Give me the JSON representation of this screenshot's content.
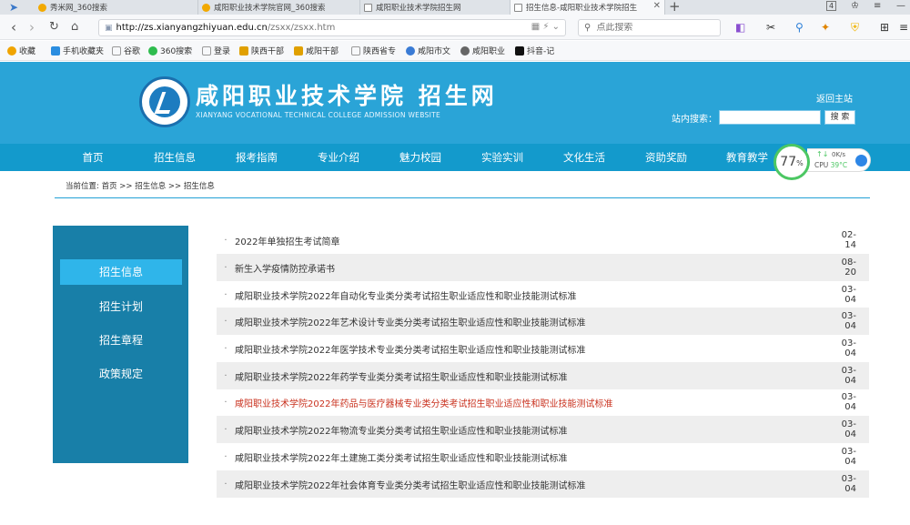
{
  "browser": {
    "tabs": [
      {
        "label": "秀米网_360搜索",
        "active": false
      },
      {
        "label": "咸阳职业技术学院官网_360搜索",
        "active": false
      },
      {
        "label": "咸阳职业技术学院招生网",
        "active": false
      },
      {
        "label": "招生信息-咸阳职业技术学院招生",
        "active": true
      }
    ],
    "tab_count_badge": "4",
    "url_host": "http://zs.xianyangzhiyuan.edu.cn",
    "url_path": "/zsxx/zsxx.htm",
    "search_placeholder": "点此搜索",
    "bookmarks": [
      {
        "label": "收藏",
        "color": "#f0a400"
      },
      {
        "label": "手机收藏夹",
        "color": "#2a8de0"
      },
      {
        "label": "谷歌",
        "color": "#999999"
      },
      {
        "label": "360搜索",
        "color": "#2ebc4e"
      },
      {
        "label": "登录",
        "color": "#999999"
      },
      {
        "label": "陕西干部",
        "color": "#e0a000"
      },
      {
        "label": "咸阳干部",
        "color": "#e0a000"
      },
      {
        "label": "陕西省专",
        "color": "#999999"
      },
      {
        "label": "咸阳市文",
        "color": "#3a7bd5"
      },
      {
        "label": "咸阳职业",
        "color": "#666666"
      },
      {
        "label": "抖音-记",
        "color": "#111111"
      }
    ]
  },
  "site": {
    "name": "咸阳职业技术学院 招生网",
    "subtitle": "XIANYANG VOCATIONAL TECHNICAL COLLEGE ADMISSION WEBSITE",
    "home_link": "返回主站",
    "search_label": "站内搜索：",
    "search_button": "搜 索",
    "nav": [
      "首页",
      "招生信息",
      "报考指南",
      "专业介绍",
      "魅力校园",
      "实验实训",
      "文化生活",
      "资助奖励",
      "教育教学"
    ]
  },
  "cpu_widget": {
    "percent": "77",
    "unit": "%",
    "speed": "0K/s",
    "cpu_label": "CPU",
    "temp": "39°C"
  },
  "breadcrumb": "当前位置: 首页 >> 招生信息 >> 招生信息",
  "sidebar": {
    "items": [
      "招生信息",
      "招生计划",
      "招生章程",
      "政策规定"
    ],
    "active_index": 0
  },
  "news": [
    {
      "title": "2022年单独招生考试简章",
      "date": "02-14",
      "highlight": false
    },
    {
      "title": "新生入学疫情防控承诺书",
      "date": "08-20",
      "highlight": false
    },
    {
      "title": "咸阳职业技术学院2022年自动化专业类分类考试招生职业适应性和职业技能测试标准",
      "date": "03-04",
      "highlight": false
    },
    {
      "title": "咸阳职业技术学院2022年艺术设计专业类分类考试招生职业适应性和职业技能测试标准",
      "date": "03-04",
      "highlight": false
    },
    {
      "title": "咸阳职业技术学院2022年医学技术专业类分类考试招生职业适应性和职业技能测试标准",
      "date": "03-04",
      "highlight": false
    },
    {
      "title": "咸阳职业技术学院2022年药学专业类分类考试招生职业适应性和职业技能测试标准",
      "date": "03-04",
      "highlight": false
    },
    {
      "title": "咸阳职业技术学院2022年药品与医疗器械专业类分类考试招生职业适应性和职业技能测试标准",
      "date": "03-04",
      "highlight": true
    },
    {
      "title": "咸阳职业技术学院2022年物流专业类分类考试招生职业适应性和职业技能测试标准",
      "date": "03-04",
      "highlight": false
    },
    {
      "title": "咸阳职业技术学院2022年土建施工类分类考试招生职业适应性和职业技能测试标准",
      "date": "03-04",
      "highlight": false
    },
    {
      "title": "咸阳职业技术学院2022年社会体育专业类分类考试招生职业适应性和职业技能测试标准",
      "date": "03-04",
      "highlight": false
    }
  ],
  "colors": {
    "header_blue": "#2aa4d7",
    "nav_blue": "#139acc",
    "sidebar_blue": "#187fa8",
    "active_item": "#2fb5ea",
    "highlight_red": "#c9311e"
  }
}
